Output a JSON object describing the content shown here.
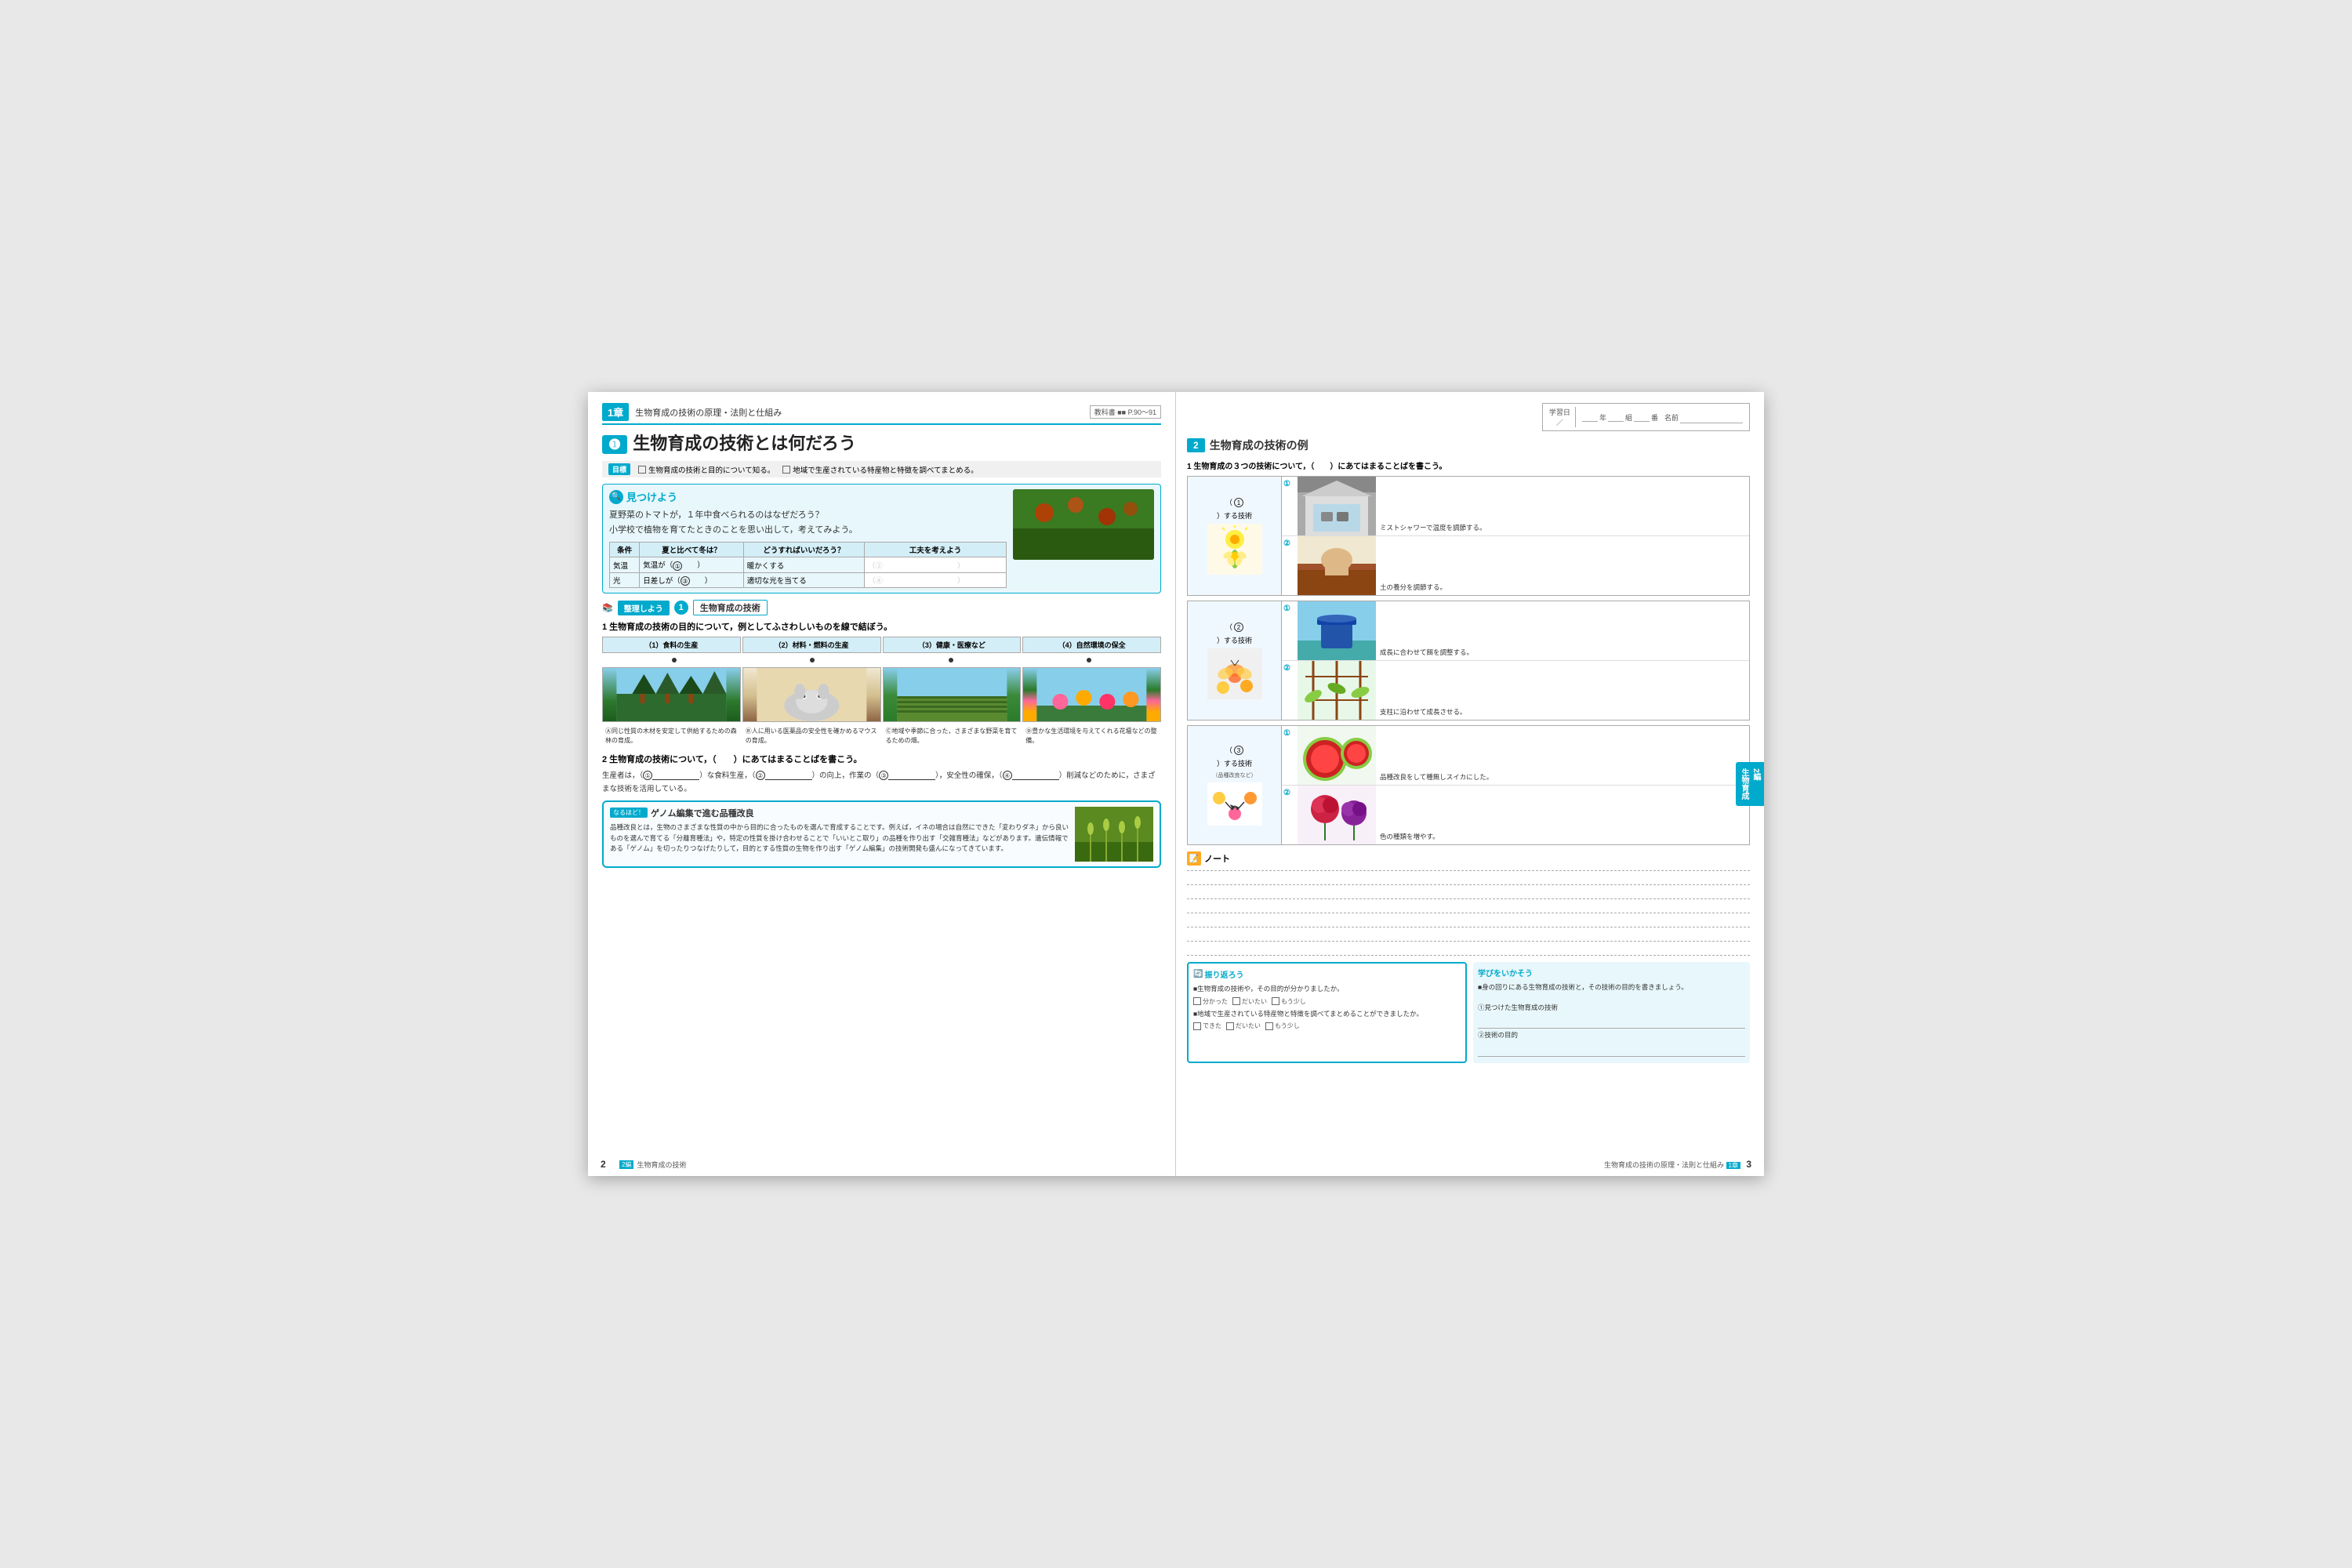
{
  "left_page": {
    "chapter": {
      "num": "1",
      "kanji": "章",
      "title": "生物育成の技術の原理・法則と仕組み",
      "textbook_ref": "教科書 ■■ P.90～91"
    },
    "section_num": "❶",
    "section_title": "生物育成の技術とは何だろう",
    "objectives": {
      "label": "目標",
      "item1": "生物育成の技術と目的について知る。",
      "item2": "地域で生産されている特産物と特徴を調べてまとめる。"
    },
    "find_section": {
      "title": "見つけよう",
      "text_line1": "夏野菜のトマトが，１年中食べられるのはなぜだろう？",
      "text_line2": "小学校で植物を育てたときのことを思い出して，考えてみよう。",
      "table": {
        "headers": [
          "条件",
          "夏と比べて冬は？",
          "どうすればいいだろう？",
          "工夫を考えよう"
        ],
        "rows": [
          [
            "気温",
            "気温が（①　　）",
            "暖かくする",
            "（②　　　　　　　　　　）"
          ],
          [
            "光",
            "日差しが（③　　）",
            "適切な光を当てる",
            "（④　　　　　　　　　　）"
          ]
        ]
      }
    },
    "organize_section": {
      "badge": "整理しよう",
      "num": "1",
      "title": "生物育成の技術",
      "q1_title": "1 生物育成の技術の目的について，例としてふさわしいものを線で結ぼう。",
      "categories": [
        "（1）食料の生産",
        "（2）材料・燃料の生産",
        "（3）健康・医療など",
        "（4）自然環境の保全"
      ],
      "images": [
        {
          "label": "Ⓐ",
          "caption": "Ⓐ同じ性質の木材を安定して供給するための森林の育成。"
        },
        {
          "label": "Ⓑ",
          "caption": "Ⓑ人に用いる医薬品の安全性を確かめるマウスの育成。"
        },
        {
          "label": "Ⓒ",
          "caption": "Ⓒ地域や季節に合った，さまざまな野菜を育てるための畑。"
        },
        {
          "label": "Ⓓ",
          "caption": "Ⓓ豊かな生活環境を与えてくれる花壇などの整備。"
        }
      ],
      "q2_title": "2 生物育成の技術について，（　　）にあてはまることばを書こう。",
      "q2_text": "生産者は，（①　　　　　　）な食料生産，（②　　　　　　　　）の向上，作業の（③　　　　　　　　），安全性の確保，（④　　　　　　　　）削減などのために，さまざまな技術を活用している。"
    },
    "genome_box": {
      "badge": "なるほど！",
      "title": "ゲノム編集で進む品種改良",
      "text": "品種改良とは，生物のさまざまな性質の中から目的に合ったものを選んで育成することです。例えば，イネの場合は自然にできた「変わりダネ」から良いものを選んで育てる「分離育種法」や，特定の性質を掛け合わせることで「いいとこ取り」の品種を作り出す「交雑育種法」などがあります。遺伝情報である「ゲノム」を切ったりつなげたりして，目的とする性質の生物を作り出す「ゲノム編集」の技術開発も盛んになってきています。"
    },
    "footer": {
      "page_num": "2",
      "badge": "2編",
      "subject": "生物育成の技術"
    }
  },
  "right_page": {
    "study_info": {
      "study_date_label": "学習日",
      "slash": "／",
      "year_label": "年",
      "class_label": "組",
      "num_label": "番",
      "name_label": "名前"
    },
    "section_num": "2",
    "section_title": "生物育成の技術の例",
    "q1_title": "1 生物育成の３つの技術について，（　　）にあてはまることばを書こう。",
    "tech_rows": [
      {
        "num": "1",
        "blank_label": "（1）",
        "suffix": "）する技術",
        "examples": [
          {
            "num": "①",
            "caption": "ミストシャワーで温度を調節する。"
          },
          {
            "num": "②",
            "caption": "土の養分を調節する。"
          }
        ]
      },
      {
        "num": "2",
        "blank_label": "（2）",
        "suffix": "）する技術",
        "examples": [
          {
            "num": "①",
            "caption": "成長に合わせて餌を調整する。"
          },
          {
            "num": "②",
            "caption": "支柱に沿わせて成長させる。"
          }
        ]
      },
      {
        "num": "3",
        "blank_label": "（3）",
        "suffix": "）する技術\n（品種改良など）",
        "examples": [
          {
            "num": "①",
            "caption": "品種改良をして種無しスイカにした。"
          },
          {
            "num": "②",
            "caption": "色の種類を増やす。"
          }
        ]
      }
    ],
    "note": {
      "title": "ノート",
      "lines": 6
    },
    "review": {
      "title": "振り返ろう",
      "items": [
        "■生物育成の技術や，その目的が分かりましたか。",
        "□分かった　□だいたい　□もう少し",
        "■地域で生産されている特産物と特徴を調べてまとめることができましたか。",
        "□できた　□だいたい　□もう少し"
      ]
    },
    "use": {
      "title": "学びをいかそう",
      "items": [
        "■身の回りにある生物育成の技術と，その技術の目的を書きましょう。",
        "①見つけた生物育成の技術",
        "②技術の目的"
      ]
    },
    "side_label_top": "2",
    "side_label_mid": "編",
    "side_label_bottom": "生物育成",
    "footer": {
      "page_num": "3",
      "text": "生物育成の技術の原理・法則と仕組み",
      "badge": "1章"
    }
  }
}
